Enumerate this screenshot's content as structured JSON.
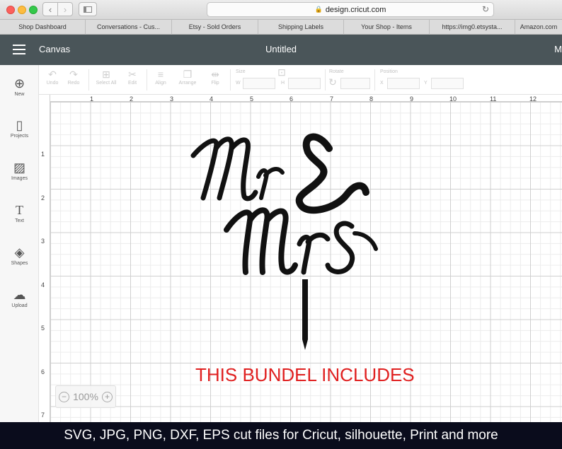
{
  "browser": {
    "url": "design.cricut.com",
    "bookmarks": [
      "Shop Dashboard",
      "Conversations - Cus...",
      "Etsy - Sold Orders",
      "Shipping Labels",
      "Your Shop - Items",
      "https://img0.etsysta...",
      "Amazon.com"
    ]
  },
  "header": {
    "app_title": "Canvas",
    "doc_title": "Untitled",
    "menu_letter": "M"
  },
  "toolbar": {
    "undo": "Undo",
    "redo": "Redo",
    "select_all": "Select All",
    "edit": "Edit",
    "align": "Align",
    "arrange": "Arrange",
    "flip": "Flip",
    "size": "Size",
    "w": "W",
    "h": "H",
    "rotate": "Rotate",
    "position": "Position",
    "x": "X",
    "y": "Y"
  },
  "sidebar": {
    "items": [
      {
        "label": "New",
        "icon": "plus-circle-icon"
      },
      {
        "label": "Projects",
        "icon": "notebook-icon"
      },
      {
        "label": "Images",
        "icon": "image-icon"
      },
      {
        "label": "Text",
        "icon": "text-t-icon"
      },
      {
        "label": "Shapes",
        "icon": "shapes-icon"
      },
      {
        "label": "Upload",
        "icon": "cloud-upload-icon"
      }
    ]
  },
  "ruler": {
    "top": [
      "1",
      "2",
      "3",
      "4",
      "5",
      "6",
      "7",
      "8",
      "9",
      "10",
      "11",
      "12"
    ],
    "left": [
      "1",
      "2",
      "3",
      "4",
      "5",
      "6",
      "7"
    ]
  },
  "canvas": {
    "zoom": "100%",
    "artwork_text": "Mr & Mrs"
  },
  "overlay": {
    "includes": "THIS BUNDEL INCLUDES",
    "formats": "SVG, JPG, PNG, DXF, EPS cut files for Cricut, silhouette, Print and more",
    "includes_color": "#e02020"
  }
}
